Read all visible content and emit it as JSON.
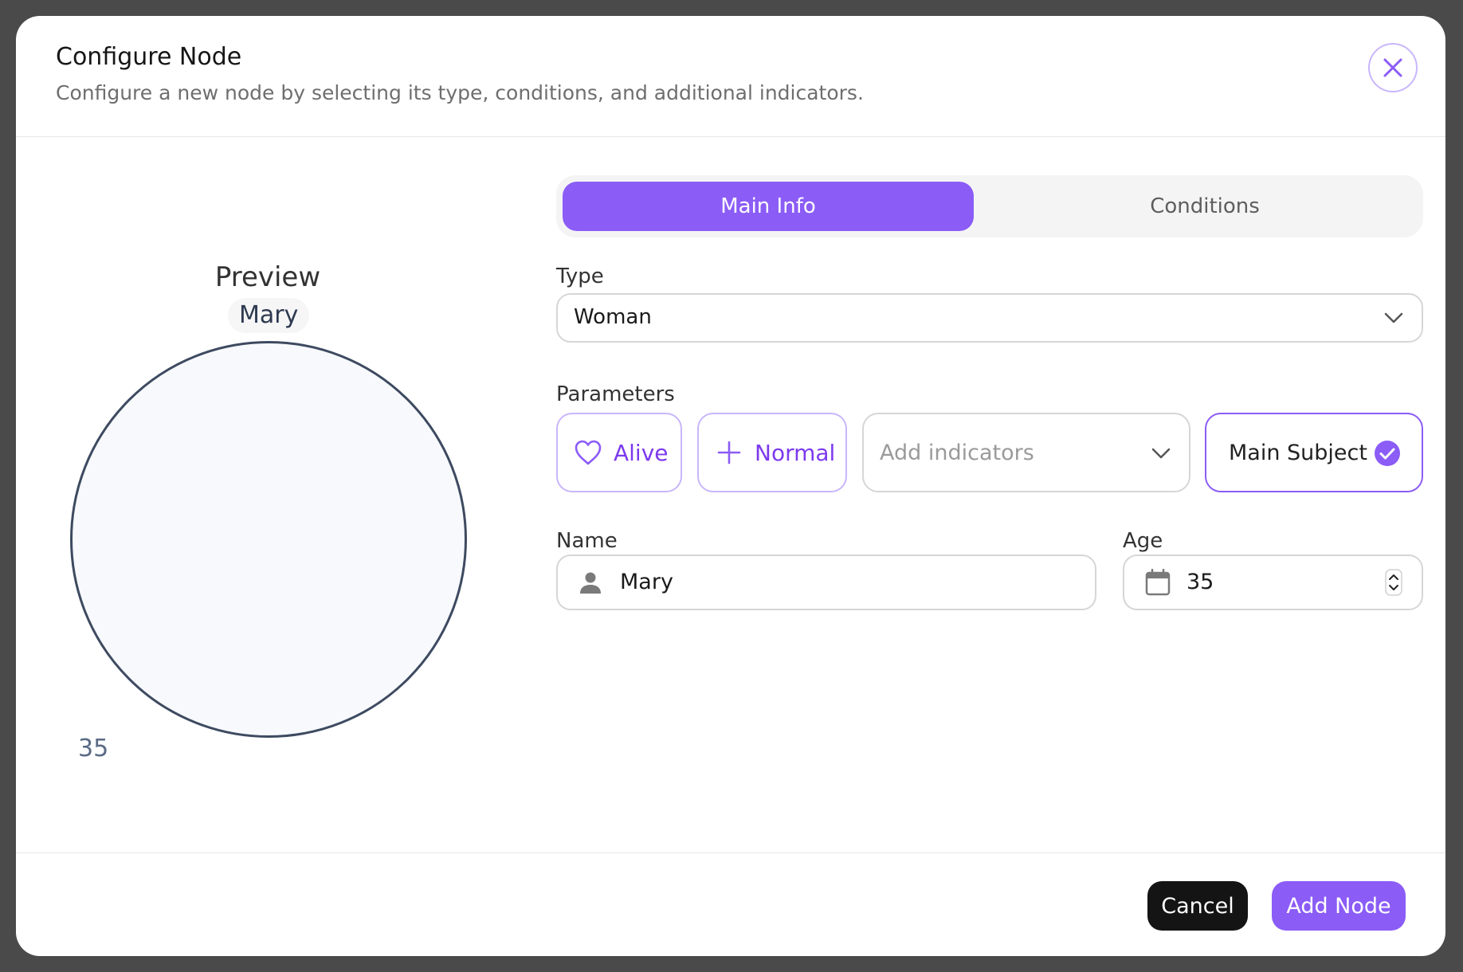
{
  "dialog": {
    "title": "Configure Node",
    "subtitle": "Configure a new node by selecting its type, conditions, and additional indicators."
  },
  "preview": {
    "label": "Preview",
    "name": "Mary",
    "age": "35"
  },
  "tabs": [
    {
      "label": "Main Info",
      "active": true
    },
    {
      "label": "Conditions",
      "active": false
    }
  ],
  "form": {
    "type_label": "Type",
    "type_value": "Woman",
    "parameters_label": "Parameters",
    "parameters": {
      "alive_label": "Alive",
      "normal_label": "Normal",
      "indicators_placeholder": "Add indicators",
      "main_subject_label": "Main Subject",
      "main_subject_checked": true
    },
    "name_label": "Name",
    "name_value": "Mary",
    "age_label": "Age",
    "age_value": "35"
  },
  "footer": {
    "cancel_label": "Cancel",
    "add_label": "Add Node"
  },
  "colors": {
    "accent": "#8b5cf6",
    "accent_border": "#c9b6fb",
    "dark_button": "#141414",
    "preview_stroke": "#3d4a60"
  }
}
